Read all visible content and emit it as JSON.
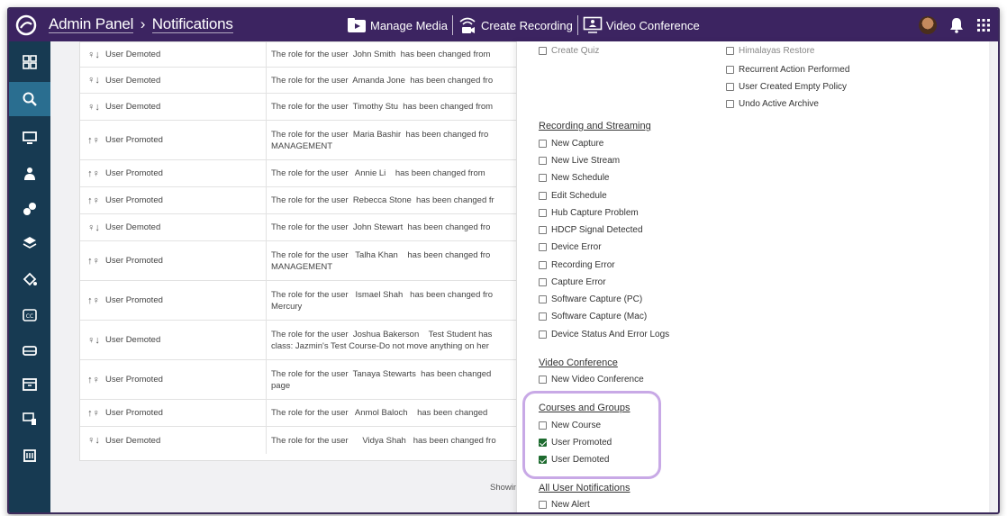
{
  "header": {
    "crumb_root": "Admin Panel",
    "crumb_sep": "›",
    "crumb_page": "Notifications",
    "tools": [
      {
        "label": "Manage Media",
        "icon": "media-icon"
      },
      {
        "label": "Create Recording",
        "icon": "recording-icon"
      },
      {
        "label": "Video Conference",
        "icon": "video-conference-icon"
      }
    ]
  },
  "sidebar_icons": [
    "dashboard-icon",
    "search-icon",
    "monitor-icon",
    "users-icon",
    "puzzle-icon",
    "layers-icon",
    "paint-icon",
    "captions-icon",
    "drive-icon",
    "archive-icon",
    "device-icon",
    "building-icon"
  ],
  "rows": [
    {
      "icon": "demote",
      "type": "User Demoted",
      "desc": [
        "The role for the user  John Smith  has been changed from"
      ]
    },
    {
      "icon": "demote",
      "type": "User Demoted",
      "desc": [
        "The role for the user  Amanda Jone  has been changed fro"
      ]
    },
    {
      "icon": "demote",
      "type": "User Demoted",
      "desc": [
        "The role for the user  Timothy Stu  has been changed from"
      ]
    },
    {
      "icon": "promote",
      "type": "User Promoted",
      "desc": [
        "The role for the user  Maria Bashir  has been changed fro",
        "MANAGEMENT"
      ]
    },
    {
      "icon": "promote",
      "type": "User Promoted",
      "desc": [
        "The role for the user   Annie Li    has been changed from"
      ]
    },
    {
      "icon": "promote",
      "type": "User Promoted",
      "desc": [
        "The role for the user  Rebecca Stone  has been changed fr"
      ]
    },
    {
      "icon": "demote",
      "type": "User Demoted",
      "desc": [
        "The role for the user  John Stewart  has been changed fro"
      ]
    },
    {
      "icon": "promote",
      "type": "User Promoted",
      "desc": [
        "The role for the user   Talha Khan    has been changed fro",
        "MANAGEMENT"
      ]
    },
    {
      "icon": "promote",
      "type": "User Promoted",
      "desc": [
        "The role for the user   Ismael Shah   has been changed fro",
        "Mercury"
      ]
    },
    {
      "icon": "demote",
      "type": "User Demoted",
      "desc": [
        "The role for the user  Joshua Bakerson    Test Student has",
        "class: Jazmin's Test Course-Do not move anything on her"
      ]
    },
    {
      "icon": "promote",
      "type": "User Promoted",
      "desc": [
        "The role for the user  Tanaya Stewarts  has been changed",
        "page"
      ]
    },
    {
      "icon": "promote",
      "type": "User Promoted",
      "desc": [
        "The role for the user   Anmol Baloch    has been changed"
      ]
    },
    {
      "icon": "demote",
      "type": "User Demoted",
      "desc": [
        "The role for the user      Vidya Shah   has been changed fro"
      ]
    }
  ],
  "showing": "Showin",
  "popup": {
    "col2_items": [
      {
        "label": "Himalayas Restore",
        "checked": false
      },
      {
        "label": "Recurrent Action Performed",
        "checked": false
      },
      {
        "label": "User Created Empty Policy",
        "checked": false
      },
      {
        "label": "Undo Active Archive",
        "checked": false
      }
    ],
    "col1_top": {
      "label": "Create Quiz",
      "checked": false
    },
    "sections": [
      {
        "title": "Recording and Streaming",
        "items": [
          {
            "label": "New Capture",
            "checked": false
          },
          {
            "label": "New Live Stream",
            "checked": false
          },
          {
            "label": "New Schedule",
            "checked": false
          },
          {
            "label": "Edit Schedule",
            "checked": false
          },
          {
            "label": "Hub Capture Problem",
            "checked": false
          },
          {
            "label": "HDCP Signal Detected",
            "checked": false
          },
          {
            "label": "Device Error",
            "checked": false
          },
          {
            "label": "Recording Error",
            "checked": false
          },
          {
            "label": "Capture Error",
            "checked": false
          },
          {
            "label": "Software Capture (PC)",
            "checked": false
          },
          {
            "label": "Software Capture (Mac)",
            "checked": false
          },
          {
            "label": "Device Status And Error Logs",
            "checked": false
          }
        ]
      },
      {
        "title": "Video Conference",
        "items": [
          {
            "label": "New Video Conference",
            "checked": false
          }
        ]
      },
      {
        "title": "Courses and Groups",
        "items": [
          {
            "label": "New Course",
            "checked": false
          },
          {
            "label": "User Promoted",
            "checked": true
          },
          {
            "label": "User Demoted",
            "checked": true
          }
        ]
      },
      {
        "title": "All User Notifications",
        "items": [
          {
            "label": "New Alert",
            "checked": false
          }
        ]
      }
    ]
  },
  "colors": {
    "topbar": "#3c2461",
    "sidebar": "#173a52",
    "sidebar_active": "#2a6e90",
    "highlight": "#c8a9e6",
    "checked": "#1e6b2f"
  }
}
